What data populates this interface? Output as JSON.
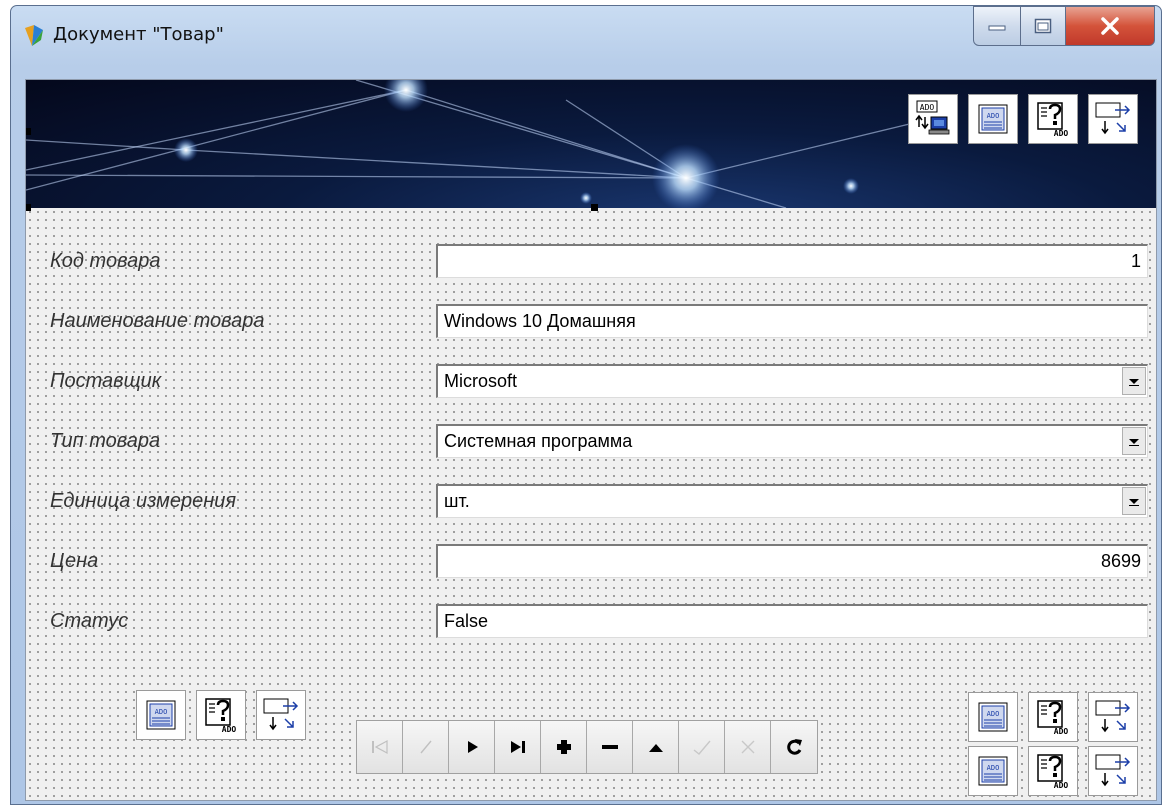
{
  "window": {
    "title": "Документ \"Товар\"",
    "close_glyph": "x"
  },
  "fields": [
    {
      "label": "Код товара",
      "value": "1",
      "kind": "text",
      "align": "right"
    },
    {
      "label": "Наименование товара",
      "value": "Windows 10 Домашняя",
      "kind": "text",
      "align": "left"
    },
    {
      "label": "Поставщик",
      "value": "Microsoft",
      "kind": "combo",
      "align": "left"
    },
    {
      "label": "Тип товара",
      "value": "Системная программа",
      "kind": "combo",
      "align": "left"
    },
    {
      "label": "Единица измерения",
      "value": "шт.",
      "kind": "combo",
      "align": "left"
    },
    {
      "label": "Цена",
      "value": "8699",
      "kind": "text",
      "align": "right"
    },
    {
      "label": "Статус",
      "value": "False",
      "kind": "text",
      "align": "left"
    }
  ],
  "ado_icon_text": "ADO",
  "navigator": {
    "buttons": [
      {
        "name": "first",
        "enabled": false
      },
      {
        "name": "prior",
        "enabled": false
      },
      {
        "name": "next",
        "enabled": true
      },
      {
        "name": "last",
        "enabled": true
      },
      {
        "name": "insert",
        "enabled": true
      },
      {
        "name": "delete",
        "enabled": true
      },
      {
        "name": "edit",
        "enabled": true
      },
      {
        "name": "post",
        "enabled": false
      },
      {
        "name": "cancel",
        "enabled": false
      },
      {
        "name": "refresh",
        "enabled": true
      }
    ]
  },
  "colors": {
    "banner_dark": "#04081c",
    "banner_light": "#1a3770",
    "close_red": "#c0392b",
    "ado_blue": "#1c3fa8"
  }
}
